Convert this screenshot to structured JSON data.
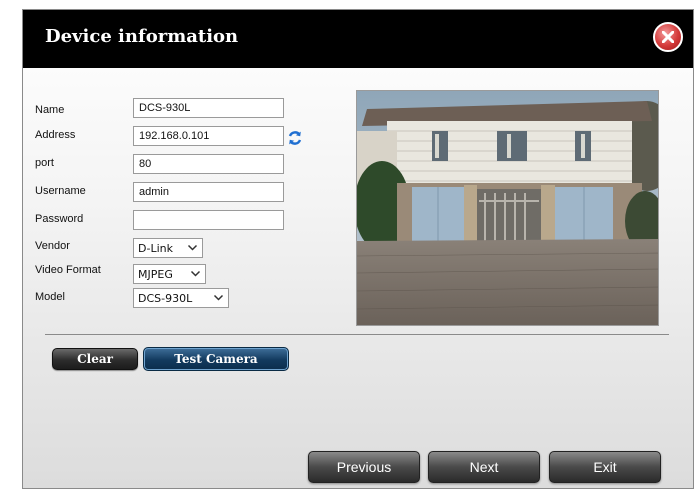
{
  "dialog": {
    "title": "Device information",
    "close_icon": "close-icon"
  },
  "form": {
    "name": {
      "label": "Name",
      "value": "DCS-930L"
    },
    "address": {
      "label": "Address",
      "value": "192.168.0.101",
      "refresh_icon": "refresh-icon"
    },
    "port": {
      "label": "port",
      "value": "80"
    },
    "username": {
      "label": "Username",
      "value": "admin"
    },
    "password": {
      "label": "Password",
      "value": ""
    },
    "vendor": {
      "label": "Vendor",
      "value": "D-Link"
    },
    "video_format": {
      "label": "Video Format",
      "value": "MJPEG"
    },
    "model": {
      "label": "Model",
      "value": "DCS-930L"
    }
  },
  "buttons": {
    "clear": "Clear",
    "test_camera": "Test Camera",
    "previous": "Previous",
    "next": "Next",
    "exit": "Exit"
  },
  "colors": {
    "title_bar": "#000000",
    "accent_blue": "#123a5e",
    "close_red": "#d43a3a"
  }
}
